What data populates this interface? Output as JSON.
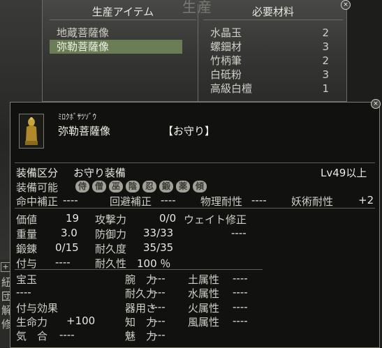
{
  "production": {
    "title": "生産",
    "left_header": "生産アイテム",
    "right_header": "必要材料",
    "items": [
      "地蔵菩薩像",
      "弥勒菩薩像"
    ],
    "materials": [
      {
        "name": "水晶玉",
        "qty": "2"
      },
      {
        "name": "螺鈿材",
        "qty": "3"
      },
      {
        "name": "竹柄筆",
        "qty": "2"
      },
      {
        "name": "白砥粉",
        "qty": "3"
      },
      {
        "name": "高級白檀",
        "qty": "1"
      }
    ]
  },
  "detail": {
    "kana": "ﾐﾛｸﾎﾞｻﾂｿﾞｳ",
    "name": "弥勒菩薩像",
    "item_type": "【お守り】",
    "equip_class_label": "装備区分",
    "equip_class_value": "お守り装備",
    "level_req": "Lv49以上",
    "equippable_label": "装備可能",
    "jobs": [
      "侍",
      "僧",
      "巫",
      "陰",
      "忍",
      "鍛",
      "薬",
      "傾"
    ],
    "hit_bonus_label": "命中補正",
    "hit_bonus_value": "----",
    "evade_bonus_label": "回避補正",
    "evade_bonus_value": "----",
    "phys_res_label": "物理耐性",
    "phys_res_value": "----",
    "magic_res_label": "妖術耐性",
    "magic_res_value": "+2",
    "price_label": "価値",
    "price_value": "19",
    "attack_label": "攻撃力",
    "attack_value": "0/0",
    "weight_mod_label": "ウェイト修正",
    "weight_mod_value": "----",
    "weight_label": "重量",
    "weight_value": "3.0",
    "defense_label": "防御力",
    "defense_value": "33/33",
    "forge_label": "鍛錬",
    "forge_value": "0/15",
    "durability_label": "耐久度",
    "durability_value": "35/35",
    "enchant_label": "付与",
    "enchant_value": "----",
    "resilience_label": "耐久性",
    "resilience_value": "100 ％",
    "gem_label": "宝玉",
    "gem_value": "----",
    "effect_label": "付与効果",
    "hp_label": "生命力",
    "hp_value": "+100",
    "ki_label": "気　合",
    "ki_value": "----",
    "arm_label": "腕　力",
    "arm_value": "----",
    "endurance_label": "耐久力",
    "endurance_value": "----",
    "dex_label": "器用さ",
    "dex_value": "----",
    "int_label": "知　力",
    "int_value": "----",
    "charm_label": "魅　力",
    "charm_value": "----",
    "earth_label": "土属性",
    "earth_value": "----",
    "water_label": "水属性",
    "water_value": "----",
    "fire_label": "火属性",
    "fire_value": "----",
    "wind_label": "風属性",
    "wind_value": "----"
  },
  "side_labels": [
    "紐",
    "団",
    "解",
    "修"
  ],
  "plus_glyph": "+",
  "close_glyph": "×"
}
